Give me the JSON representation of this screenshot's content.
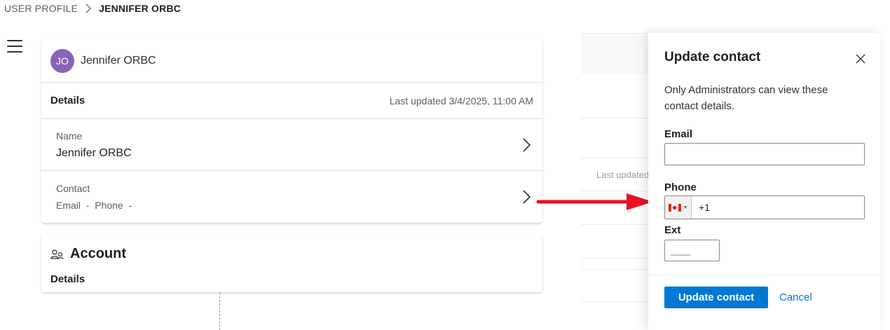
{
  "breadcrumb": {
    "parent": "USER PROFILE",
    "current": "JENNIFER ORBC"
  },
  "profile": {
    "initials": "JO",
    "name": "Jennifer ORBC",
    "avatar_color": "#8764b8",
    "details_title": "Details",
    "last_updated": "Last updated 3/4/2025, 11:00 AM",
    "fields": [
      {
        "label": "Name",
        "value": "Jennifer ORBC"
      },
      {
        "label": "Contact",
        "value": "Email  -  Phone  -"
      }
    ]
  },
  "account": {
    "title": "Account",
    "details_title": "Details"
  },
  "background": {
    "last_updated_fragment": "Last updated"
  },
  "panel": {
    "title": "Update contact",
    "description": "Only Administrators can view these contact details.",
    "email": {
      "label": "Email",
      "value": ""
    },
    "phone": {
      "label": "Phone",
      "country_code": "+1",
      "flag": "canada-flag-icon"
    },
    "ext": {
      "label": "Ext",
      "value": "____"
    },
    "primary_button": "Update contact",
    "cancel": "Cancel",
    "primary_color": "#0078d4"
  },
  "annotation": {
    "arrow_color": "#e81123"
  }
}
